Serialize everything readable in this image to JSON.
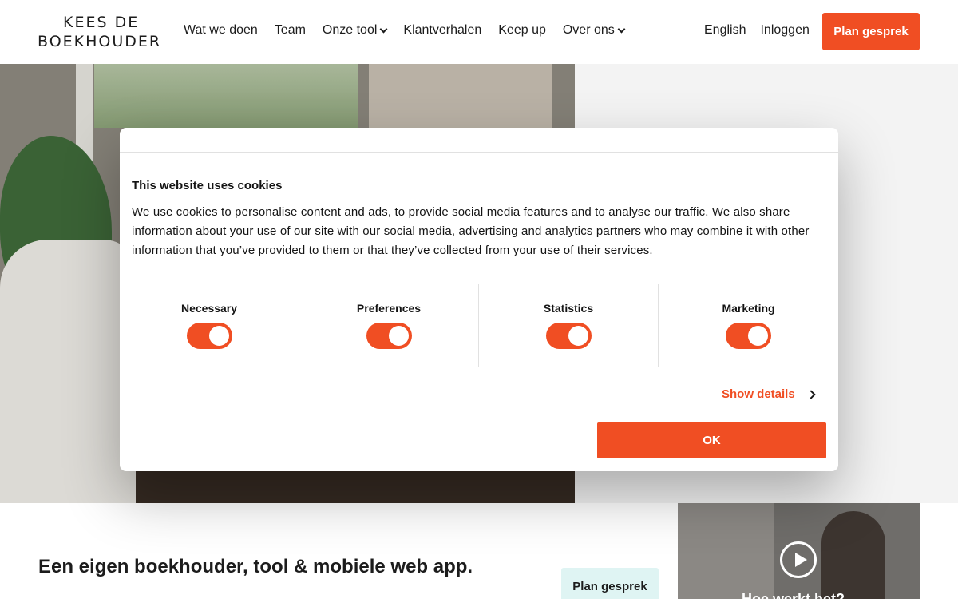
{
  "brand": {
    "logo_line1": "Kees de",
    "logo_line2": "Boekhouder"
  },
  "nav": {
    "items": [
      {
        "label": "Wat we doen",
        "dropdown": false
      },
      {
        "label": "Team",
        "dropdown": false
      },
      {
        "label": "Onze tool",
        "dropdown": true
      },
      {
        "label": "Klantverhalen",
        "dropdown": false
      },
      {
        "label": "Keep up",
        "dropdown": false
      },
      {
        "label": "Over ons",
        "dropdown": true
      }
    ],
    "language": "English",
    "login": "Inloggen",
    "cta": "Plan gesprek"
  },
  "hero": {
    "tagline": "Een eigen boekhouder, tool & mobiele web app.",
    "cta": "Plan gesprek",
    "video_caption": "Hoe werkt het?"
  },
  "cookie_dialog": {
    "title": "This website uses cookies",
    "body": "We use cookies to personalise content and ads, to provide social media features and to analyse our traffic. We also share information about your use of our site with our social media, advertising and analytics partners who may combine it with other information that you’ve provided to them or that they’ve collected from your use of their services.",
    "categories": [
      {
        "label": "Necessary",
        "enabled": true
      },
      {
        "label": "Preferences",
        "enabled": true
      },
      {
        "label": "Statistics",
        "enabled": true
      },
      {
        "label": "Marketing",
        "enabled": true
      }
    ],
    "show_details": "Show details",
    "ok": "OK"
  },
  "colors": {
    "accent": "#f04e23",
    "secondary_button": "#dff4f3"
  }
}
